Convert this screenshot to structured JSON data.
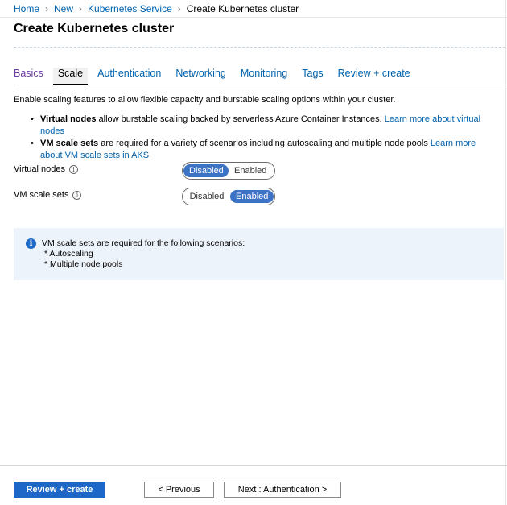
{
  "breadcrumb": {
    "items": [
      "Home",
      "New",
      "Kubernetes Service"
    ],
    "current": "Create Kubernetes cluster",
    "separator": ">"
  },
  "page": {
    "title": "Create Kubernetes cluster"
  },
  "tabs": {
    "basics": "Basics",
    "scale": "Scale",
    "authentication": "Authentication",
    "networking": "Networking",
    "monitoring": "Monitoring",
    "tags": "Tags",
    "review": "Review + create",
    "active": "Scale"
  },
  "intro": "Enable scaling features to allow flexible capacity and burstable scaling options within your cluster.",
  "bullets": [
    {
      "term": "Virtual nodes",
      "text": " allow burstable scaling backed by serverless Azure Container Instances. ",
      "link": "Learn more about virtual nodes"
    },
    {
      "term": "VM scale sets",
      "text": " are required for a variety of scenarios including autoscaling and multiple node pools ",
      "link": "Learn more about VM scale sets in AKS"
    }
  ],
  "fields": {
    "virtual_nodes": {
      "label": "Virtual nodes",
      "info_icon": "info-circle-icon",
      "options": [
        "Disabled",
        "Enabled"
      ],
      "selected": "Disabled"
    },
    "vm_scale_sets": {
      "label": "VM scale sets",
      "info_icon": "info-circle-icon",
      "options": [
        "Disabled",
        "Enabled"
      ],
      "selected": "Enabled"
    }
  },
  "info_box": {
    "icon": "info-icon",
    "title": "VM scale sets are required for the following scenarios:",
    "lines": [
      "* Autoscaling",
      "* Multiple node pools"
    ]
  },
  "footer": {
    "review_create": "Review + create",
    "previous": "< Previous",
    "next": "Next : Authentication >"
  },
  "colors": {
    "link": "#0062ad",
    "visited_link": "#6d3ba0",
    "primary": "#1c67c8",
    "toggle_on": "#3c73c5",
    "info_bg": "#edf3fb"
  }
}
